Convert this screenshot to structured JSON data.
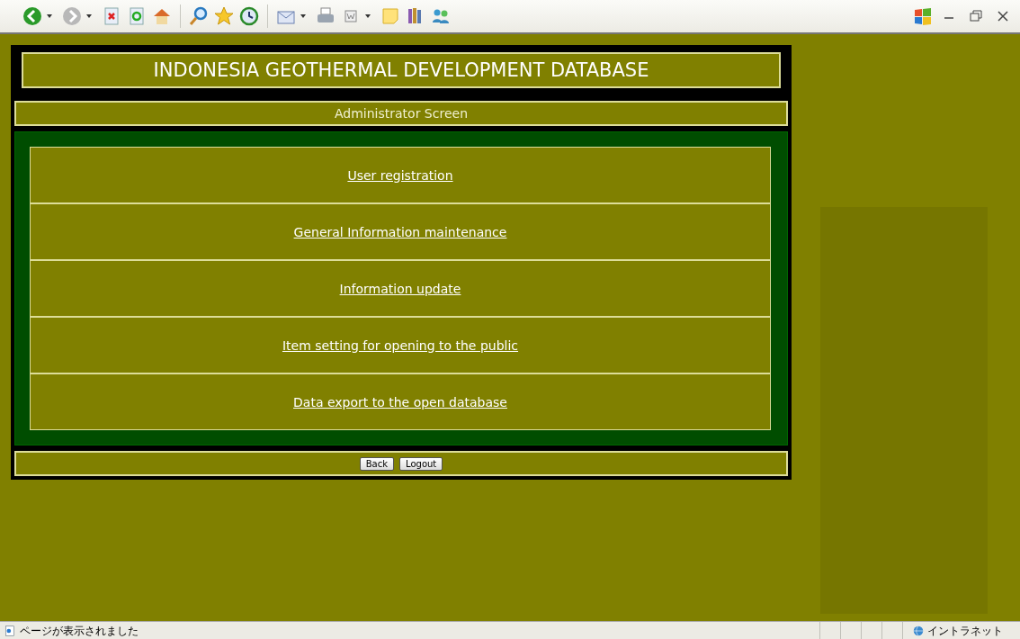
{
  "page": {
    "title": "INDONESIA GEOTHERMAL DEVELOPMENT DATABASE",
    "subtitle": "Administrator Screen",
    "menu": [
      {
        "label": "User registration"
      },
      {
        "label": "General Information maintenance"
      },
      {
        "label": "Information update"
      },
      {
        "label": "Item setting for opening to the public"
      },
      {
        "label": "Data export to the open database"
      }
    ],
    "buttons": [
      "Back",
      "Logout"
    ]
  },
  "status_bar": {
    "message": "ページが表示されました",
    "zone": "イントラネット"
  }
}
